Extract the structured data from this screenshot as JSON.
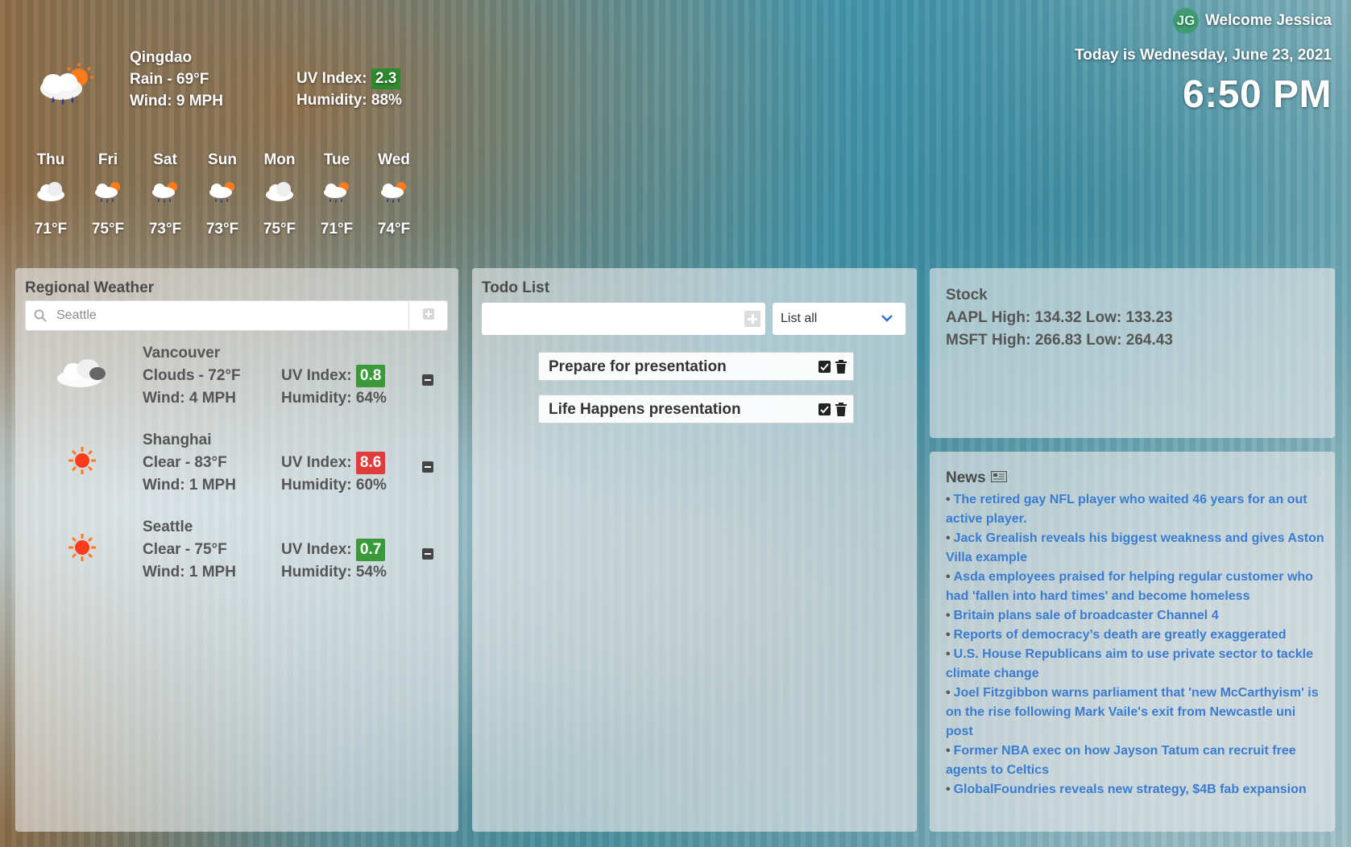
{
  "current": {
    "city": "Qingdao",
    "condition": "Rain - 69°F",
    "wind": "Wind: 9 MPH",
    "uv_label": "UV Index:",
    "uv_value": "2.3",
    "uv_color": "#2e8b2e",
    "humidity": "Humidity: 88%",
    "icon": "rain-sun-icon"
  },
  "forecast": [
    {
      "day": "Thu",
      "temp": "71°F",
      "icon": "cloud-icon"
    },
    {
      "day": "Fri",
      "temp": "75°F",
      "icon": "rain-sun-icon"
    },
    {
      "day": "Sat",
      "temp": "73°F",
      "icon": "rain-sun-icon"
    },
    {
      "day": "Sun",
      "temp": "73°F",
      "icon": "rain-sun-icon"
    },
    {
      "day": "Mon",
      "temp": "75°F",
      "icon": "cloud-icon"
    },
    {
      "day": "Tue",
      "temp": "71°F",
      "icon": "rain-sun-icon"
    },
    {
      "day": "Wed",
      "temp": "74°F",
      "icon": "rain-sun-icon"
    }
  ],
  "user": {
    "initials": "JG",
    "welcome": "Welcome Jessica",
    "date_text": "Today is Wednesday, June 23, 2021",
    "time": "6:50 PM"
  },
  "regional": {
    "title": "Regional Weather",
    "search_placeholder": "Seattle",
    "cities": [
      {
        "name": "Vancouver",
        "condition": "Clouds - 72°F",
        "wind": "Wind: 4 MPH",
        "uv_label": "UV Index:",
        "uv": "0.8",
        "uv_color": "#3a9a3a",
        "humidity": "Humidity: 64%",
        "icon": "cloud-icon"
      },
      {
        "name": "Shanghai",
        "condition": "Clear - 83°F",
        "wind": "Wind: 1 MPH",
        "uv_label": "UV Index:",
        "uv": "8.6",
        "uv_color": "#e03c3c",
        "humidity": "Humidity: 60%",
        "icon": "sun-icon"
      },
      {
        "name": "Seattle",
        "condition": "Clear - 75°F",
        "wind": "Wind: 1 MPH",
        "uv_label": "UV Index:",
        "uv": "0.7",
        "uv_color": "#3a9a3a",
        "humidity": "Humidity: 54%",
        "icon": "sun-icon"
      }
    ]
  },
  "todo": {
    "title": "Todo List",
    "input_value": "",
    "filter": "List all",
    "items": [
      {
        "label": "Prepare for presentation"
      },
      {
        "label": "Life Happens presentation"
      }
    ]
  },
  "stock": {
    "title": "Stock",
    "lines": [
      "AAPL High: 134.32 Low: 133.23",
      "MSFT High: 266.83 Low: 264.43"
    ]
  },
  "news": {
    "title": "News",
    "items": [
      "The retired gay NFL player who waited 46 years for an out active player.",
      "Jack Grealish reveals his biggest weakness and gives Aston Villa example",
      "Asda employees praised for helping regular customer who had 'fallen into hard times' and become homeless",
      "Britain plans sale of broadcaster Channel 4",
      "Reports of democracy’s death are greatly exaggerated",
      "U.S. House Republicans aim to use private sector to tackle climate change",
      "Joel Fitzgibbon warns parliament that 'new McCarthyism' is on the rise following Mark Vaile's exit from Newcastle uni post",
      "Former NBA exec on how Jayson Tatum can recruit free agents to Celtics",
      "GlobalFoundries reveals new strategy, $4B fab expansion"
    ]
  }
}
